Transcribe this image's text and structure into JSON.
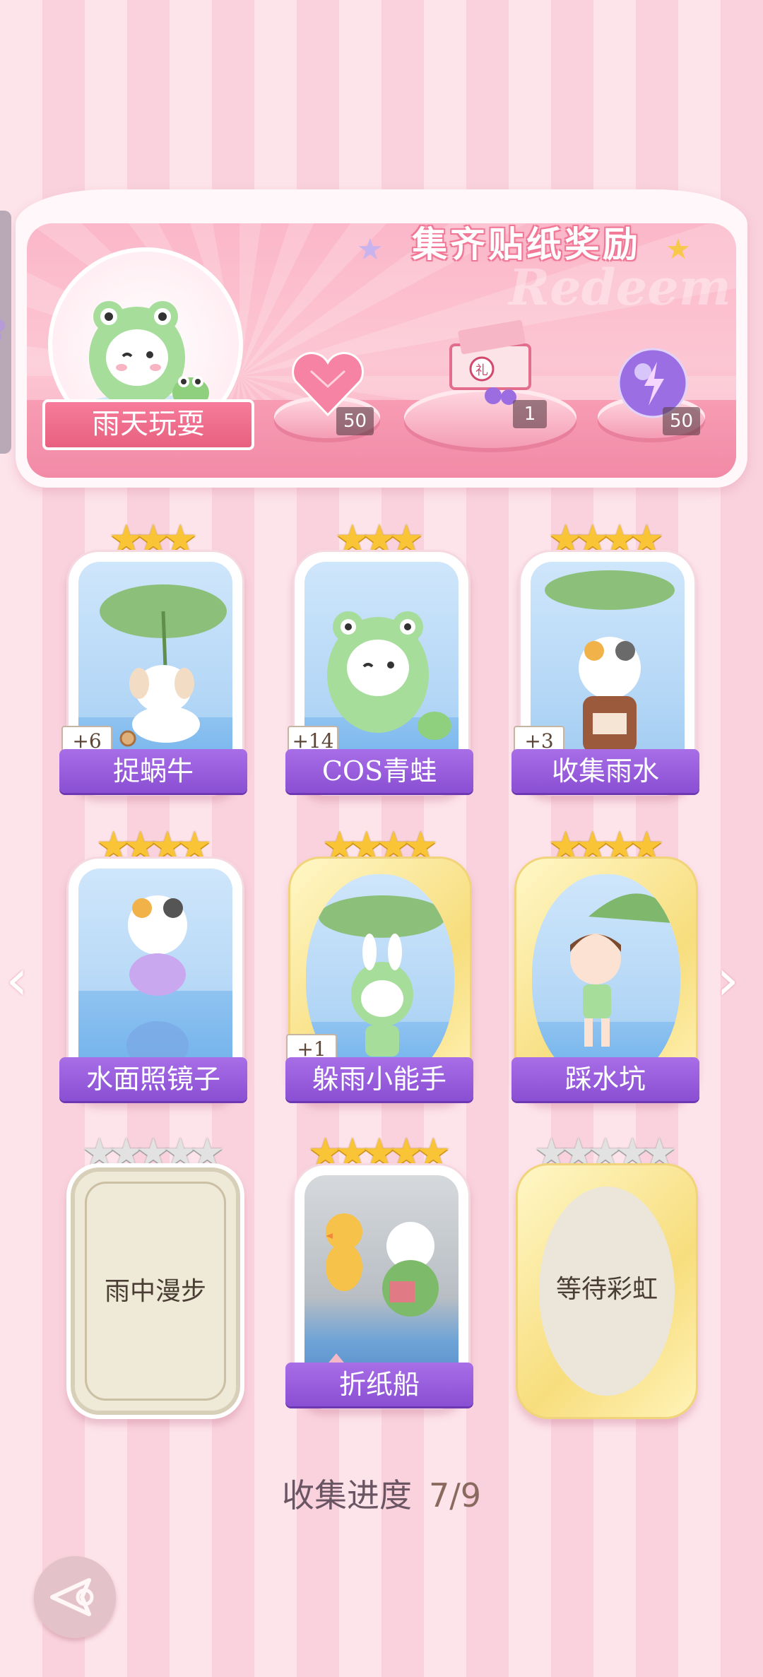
{
  "banner": {
    "title": "集齐贴纸奖励",
    "watermark": "Redeem",
    "feature_name": "雨天玩耍",
    "rewards": [
      {
        "icon": "pink-heart-gem-icon",
        "count": "50"
      },
      {
        "icon": "gift-box-icon",
        "count": "1"
      },
      {
        "icon": "purple-energy-orb-icon",
        "count": "50"
      }
    ]
  },
  "stickers": [
    {
      "name": "捉蜗牛",
      "stars": 3,
      "bonus": "+6",
      "frame": "white",
      "collected": true
    },
    {
      "name": "COS青蛙",
      "stars": 3,
      "bonus": "+14",
      "frame": "white",
      "collected": true
    },
    {
      "name": "收集雨水",
      "stars": 4,
      "bonus": "+3",
      "frame": "white",
      "collected": true
    },
    {
      "name": "水面照镜子",
      "stars": 4,
      "bonus": "",
      "frame": "white",
      "collected": true
    },
    {
      "name": "躲雨小能手",
      "stars": 4,
      "bonus": "+1",
      "frame": "gold",
      "collected": true
    },
    {
      "name": "踩水坑",
      "stars": 4,
      "bonus": "",
      "frame": "gold",
      "collected": true
    },
    {
      "name": "雨中漫步",
      "stars": 5,
      "bonus": "",
      "frame": "cream",
      "collected": false
    },
    {
      "name": "折纸船",
      "stars": 5,
      "bonus": "",
      "frame": "white",
      "collected": true
    },
    {
      "name": "等待彩虹",
      "stars": 5,
      "bonus": "",
      "frame": "gold",
      "collected": false
    }
  ],
  "progress": {
    "label": "收集进度",
    "value": "7/9"
  },
  "colors": {
    "accent_purple": "#9a5fdd",
    "star_gold": "#f9c536",
    "banner_pink": "#f77c9b"
  }
}
